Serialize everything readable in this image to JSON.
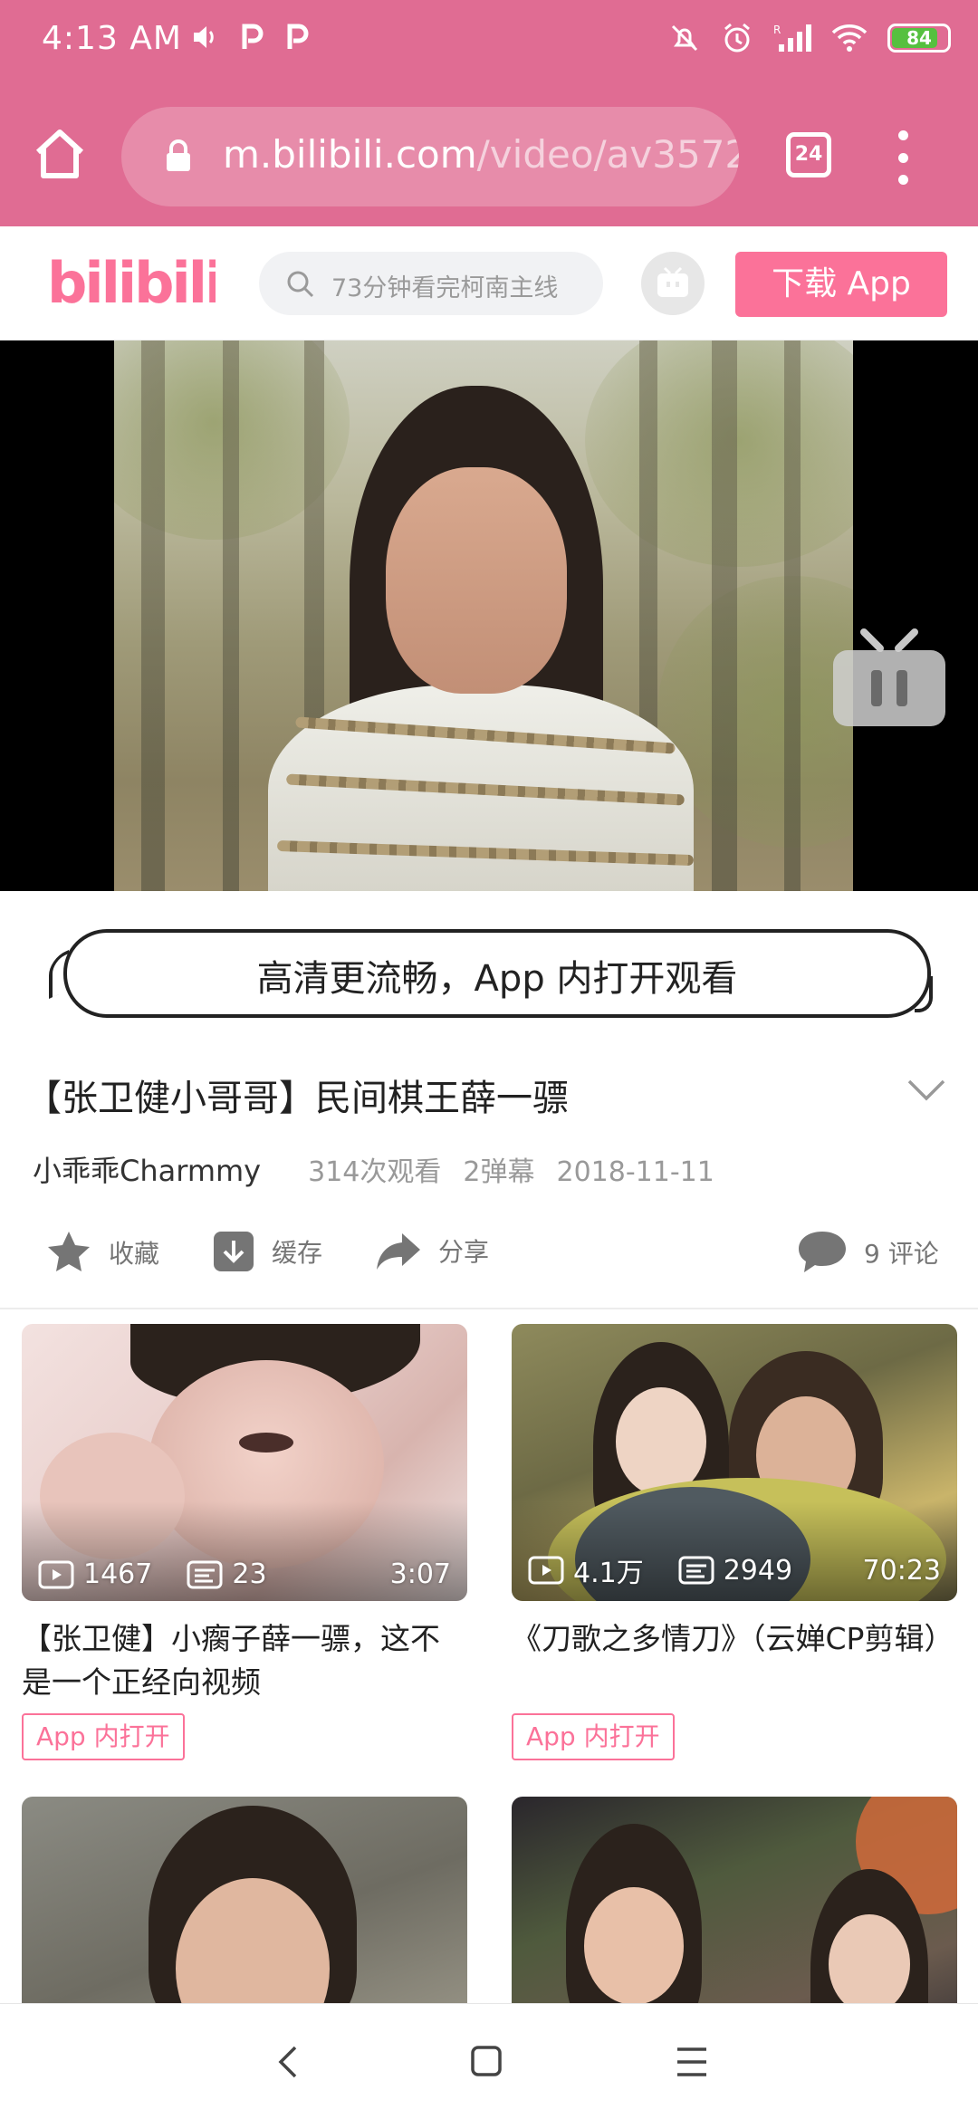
{
  "status_bar": {
    "time": "4:13 AM",
    "left_icons": [
      "volume-icon",
      "parking-p-icon",
      "parking-p-icon"
    ],
    "right_icons": [
      "dnd-icon",
      "alarm-icon",
      "signal-icon",
      "wifi-icon"
    ],
    "battery": 84,
    "battery_color": "#56c03f"
  },
  "browser": {
    "url_host": "m.bilibili.com",
    "url_path": "/video/av3572",
    "tab_count": "24"
  },
  "header": {
    "logo_text": "bilibili",
    "search_placeholder": "73分钟看完柯南主线",
    "download_label": "下载 App",
    "brand_color": "#fb7299"
  },
  "banner": {
    "text": "高清更流畅，App 内打开观看"
  },
  "video": {
    "title": "【张卫健小哥哥】民间棋王薛一骠",
    "uploader": "小乖乖Charmmy",
    "views": "314次观看",
    "danmaku": "2弹幕",
    "date": "2018-11-11"
  },
  "actions": {
    "favorite": "收藏",
    "cache": "缓存",
    "share": "分享",
    "comments": "9 评论"
  },
  "recommendations": [
    {
      "title": "【张卫健】小瘸子薛一骠，这不是一个正经向视频",
      "plays": "1467",
      "danmaku": "23",
      "duration": "3:07",
      "open_label": "App 内打开"
    },
    {
      "title": "《刀歌之多情刀》（云婵CP剪辑）",
      "plays": "4.1万",
      "danmaku": "2949",
      "duration": "70:23",
      "open_label": "App 内打开"
    },
    {
      "title": "",
      "plays": "",
      "danmaku": "",
      "duration": "",
      "open_label": ""
    },
    {
      "title": "",
      "plays": "",
      "danmaku": "",
      "duration": "",
      "open_label": ""
    }
  ],
  "nav": {
    "buttons": [
      "back-icon",
      "home-icon",
      "recents-icon"
    ]
  }
}
